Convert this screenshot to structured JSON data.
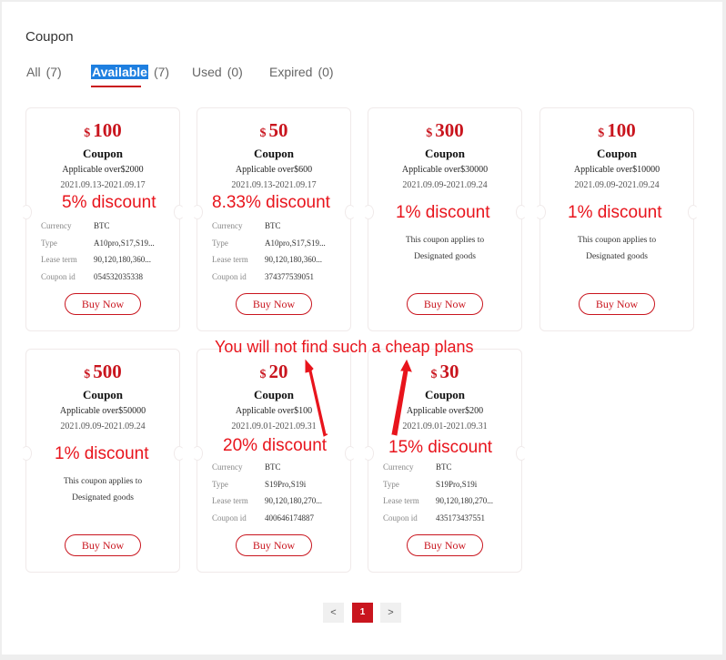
{
  "page": {
    "title": "Coupon"
  },
  "tabs": [
    {
      "label": "All",
      "count": "(7)"
    },
    {
      "label": "Available",
      "count": "(7)"
    },
    {
      "label": "Used",
      "count": "(0)"
    },
    {
      "label": "Expired",
      "count": "(0)"
    }
  ],
  "labels": {
    "currency": "Currency",
    "type": "Type",
    "lease_term": "Lease term",
    "coupon_id": "Coupon id",
    "buy_now": "Buy Now"
  },
  "coupons": [
    {
      "currency_symbol": "$",
      "amount": "100",
      "type_label": "Coupon",
      "condition": "Applicable over$2000",
      "dates": "2021.09.13-2021.09.17",
      "currency": "BTC",
      "type": "A10pro,S17,S19...",
      "lease_term": "90,120,180,360...",
      "coupon_id": "054532035338"
    },
    {
      "currency_symbol": "$",
      "amount": "50",
      "type_label": "Coupon",
      "condition": "Applicable over$600",
      "dates": "2021.09.13-2021.09.17",
      "currency": "BTC",
      "type": "A10pro,S17,S19...",
      "lease_term": "90,120,180,360...",
      "coupon_id": "374377539051"
    },
    {
      "currency_symbol": "$",
      "amount": "300",
      "type_label": "Coupon",
      "condition": "Applicable over$30000",
      "dates": "2021.09.09-2021.09.24",
      "applies_line1": "This coupon applies to",
      "applies_line2": "Designated goods"
    },
    {
      "currency_symbol": "$",
      "amount": "100",
      "type_label": "Coupon",
      "condition": "Applicable over$10000",
      "dates": "2021.09.09-2021.09.24",
      "applies_line1": "This coupon applies to",
      "applies_line2": "Designated goods"
    },
    {
      "currency_symbol": "$",
      "amount": "500",
      "type_label": "Coupon",
      "condition": "Applicable over$50000",
      "dates": "2021.09.09-2021.09.24",
      "applies_line1": "This coupon applies to",
      "applies_line2": "Designated goods"
    },
    {
      "currency_symbol": "$",
      "amount": "20",
      "type_label": "Coupon",
      "condition": "Applicable over$100",
      "dates": "2021.09.01-2021.09.31",
      "currency": "BTC",
      "type": "S19Pro,S19i",
      "lease_term": "90,120,180,270...",
      "coupon_id": "400646174887"
    },
    {
      "currency_symbol": "$",
      "amount": "30",
      "type_label": "Coupon",
      "condition": "Applicable over$200",
      "dates": "2021.09.01-2021.09.31",
      "currency": "BTC",
      "type": "S19Pro,S19i",
      "lease_term": "90,120,180,270...",
      "coupon_id": "435173437551"
    }
  ],
  "annotations": {
    "discounts": [
      "5% discount",
      "8.33% discount",
      "1% discount",
      "1% discount",
      "1% discount",
      "20% discount",
      "15% discount"
    ],
    "headline": "You will not find such a cheap plans",
    "color": "#e8141c"
  },
  "pagination": {
    "prev": "<",
    "current": "1",
    "next": ">"
  },
  "colors": {
    "accent": "#c9151e",
    "tab_highlight": "#1e7fe0"
  }
}
